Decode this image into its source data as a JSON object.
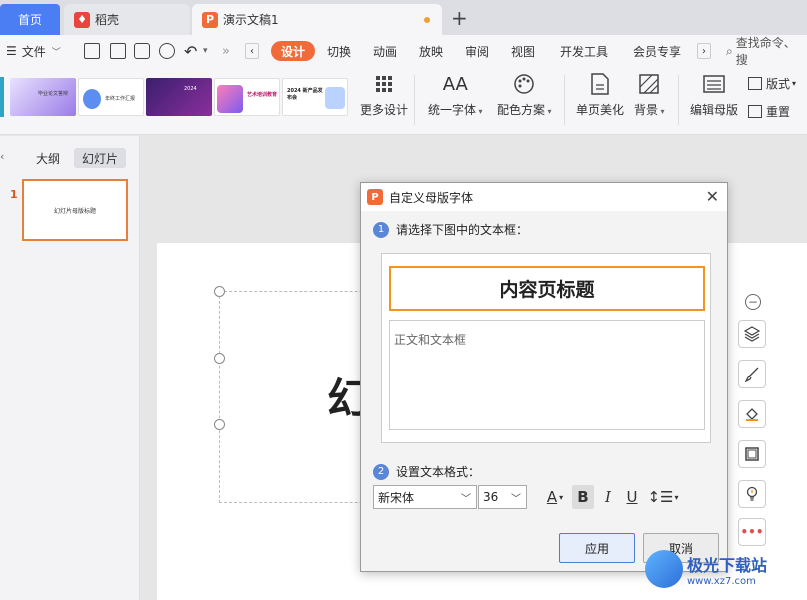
{
  "tabs": {
    "home": "首页",
    "daoke": "稻壳",
    "doc": "演示文稿1"
  },
  "menubar": {
    "file": "文件",
    "items": [
      "设计",
      "切换",
      "动画",
      "放映",
      "审阅",
      "视图",
      "开发工具",
      "会员专享"
    ],
    "search": "查找命令、搜"
  },
  "ribbon": {
    "more_design": "更多设计",
    "unify_font": "统一字体",
    "color_scheme": "配色方案",
    "single_page": "单页美化",
    "background": "背景",
    "edit_master": "编辑母版",
    "layout": "版式",
    "reset": "重置",
    "thumbnails": [
      {
        "label": "毕业论文答辩",
        "color": "#9a7be8"
      },
      {
        "label": "年终工作汇报",
        "color": "#ffffff"
      },
      {
        "label": "2024",
        "color": "#5a2f8c"
      },
      {
        "label": "艺术培训教育",
        "color": "#ffffff"
      },
      {
        "label": "2024 新产品发布会",
        "color": "#ffffff"
      }
    ]
  },
  "leftpanel": {
    "outline": "大纲",
    "slides": "幻灯片",
    "slide_number": "1",
    "slide_title": "幻灯片母版标题"
  },
  "canvas": {
    "big_char": "幻"
  },
  "dialog": {
    "title": "自定义母版字体",
    "step1_num": "1",
    "step1": "请选择下图中的文本框：",
    "preview_title": "内容页标题",
    "preview_body": "正文和文本框",
    "step2_num": "2",
    "step2": "设置文本格式：",
    "font": "新宋体",
    "size": "36",
    "apply": "应用",
    "cancel": "取消"
  },
  "watermark": {
    "line1": "极光下载站",
    "line2": "www.xz7.com"
  },
  "colors": {
    "accent": "#f06a3a",
    "home_tab": "#4b7df3",
    "selection": "#f0961e"
  }
}
